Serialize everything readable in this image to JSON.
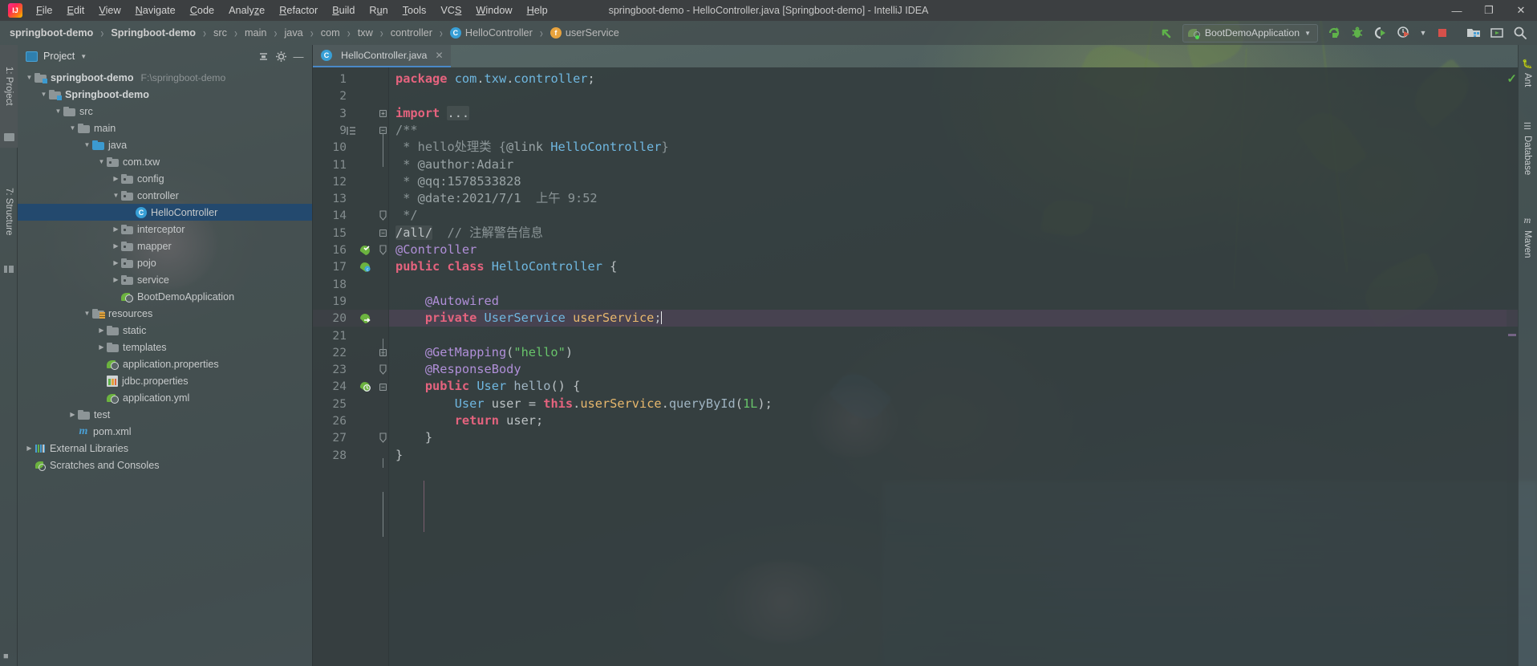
{
  "window": {
    "title": "springboot-demo - HelloController.java [Springboot-demo] - IntelliJ IDEA",
    "minimize_label": "—",
    "maximize_label": "❐",
    "close_label": "✕"
  },
  "menu": {
    "logo_name": "intellij-idea-logo",
    "items": [
      {
        "label": "File",
        "mnemonic": "F"
      },
      {
        "label": "Edit",
        "mnemonic": "E"
      },
      {
        "label": "View",
        "mnemonic": "V"
      },
      {
        "label": "Navigate",
        "mnemonic": "N"
      },
      {
        "label": "Code",
        "mnemonic": "C"
      },
      {
        "label": "Analyze",
        "mnemonic": "z"
      },
      {
        "label": "Refactor",
        "mnemonic": "R"
      },
      {
        "label": "Build",
        "mnemonic": "B"
      },
      {
        "label": "Run",
        "mnemonic": "u"
      },
      {
        "label": "Tools",
        "mnemonic": "T"
      },
      {
        "label": "VCS",
        "mnemonic": "S"
      },
      {
        "label": "Window",
        "mnemonic": "W"
      },
      {
        "label": "Help",
        "mnemonic": "H"
      }
    ]
  },
  "breadcrumb": [
    {
      "label": "springboot-demo",
      "bold": true,
      "icon": ""
    },
    {
      "label": "Springboot-demo",
      "bold": true,
      "icon": ""
    },
    {
      "label": "src",
      "bold": false,
      "icon": ""
    },
    {
      "label": "main",
      "bold": false,
      "icon": ""
    },
    {
      "label": "java",
      "bold": false,
      "icon": ""
    },
    {
      "label": "com",
      "bold": false,
      "icon": ""
    },
    {
      "label": "txw",
      "bold": false,
      "icon": ""
    },
    {
      "label": "controller",
      "bold": false,
      "icon": ""
    },
    {
      "label": "HelloController",
      "bold": false,
      "icon": "class-icon"
    },
    {
      "label": "userService",
      "bold": false,
      "icon": "field-icon"
    }
  ],
  "toolbar": {
    "back_arrow_name": "navigate-back-icon",
    "run_config": {
      "label": "BootDemoApplication",
      "icon_name": "spring-boot-icon",
      "chevron": "▼"
    },
    "buttons": [
      {
        "name": "run-button",
        "glyph": "run",
        "color": "#5fb24a"
      },
      {
        "name": "debug-button",
        "glyph": "debug",
        "color": "#5fb24a"
      },
      {
        "name": "run-with-coverage-button",
        "glyph": "coverage",
        "color": "#5fb24a"
      },
      {
        "name": "profile-button",
        "glyph": "profile",
        "color": "#d65c4a"
      },
      {
        "name": "profile-dropdown",
        "glyph": "chevron",
        "color": "#c0c5c7"
      },
      {
        "name": "stop-button",
        "glyph": "stop",
        "color": "#d6504a"
      },
      {
        "name": "project-structure-button",
        "glyph": "structure",
        "color": "#4a9fd4"
      },
      {
        "name": "update-project-button",
        "glyph": "update",
        "color": "#5fb24a"
      },
      {
        "name": "search-everywhere-button",
        "glyph": "search",
        "color": "#c6cacb"
      }
    ]
  },
  "left_stripe": [
    {
      "label": "1: Project",
      "name": "stripe-project",
      "active": true
    },
    {
      "label": "7: Structure",
      "name": "stripe-structure",
      "active": false
    }
  ],
  "right_stripe": [
    {
      "label": "Ant",
      "name": "stripe-ant"
    },
    {
      "label": "Database",
      "name": "stripe-database"
    },
    {
      "label": "Maven",
      "name": "stripe-maven"
    }
  ],
  "project_panel": {
    "title": "Project",
    "chevron": "▼",
    "collapse_all_label": "≡",
    "settings_label": "⚙",
    "hide_label": "—",
    "tree": [
      {
        "label": "springboot-demo",
        "path": "F:\\springboot-demo",
        "indent": 0,
        "arrow": "down",
        "icon": "module-folder",
        "bold": true,
        "selected": false
      },
      {
        "label": "Springboot-demo",
        "path": "",
        "indent": 1,
        "arrow": "down",
        "icon": "module-folder",
        "bold": true,
        "selected": false
      },
      {
        "label": "src",
        "path": "",
        "indent": 2,
        "arrow": "down",
        "icon": "folder",
        "bold": false,
        "selected": false
      },
      {
        "label": "main",
        "path": "",
        "indent": 3,
        "arrow": "down",
        "icon": "folder",
        "bold": false,
        "selected": false
      },
      {
        "label": "java",
        "path": "",
        "indent": 4,
        "arrow": "down",
        "icon": "source-folder",
        "bold": false,
        "selected": false
      },
      {
        "label": "com.txw",
        "path": "",
        "indent": 5,
        "arrow": "down",
        "icon": "package",
        "bold": false,
        "selected": false
      },
      {
        "label": "config",
        "path": "",
        "indent": 6,
        "arrow": "right",
        "icon": "package",
        "bold": false,
        "selected": false
      },
      {
        "label": "controller",
        "path": "",
        "indent": 6,
        "arrow": "down",
        "icon": "package",
        "bold": false,
        "selected": false
      },
      {
        "label": "HelloController",
        "path": "",
        "indent": 7,
        "arrow": "none",
        "icon": "class",
        "bold": false,
        "selected": true
      },
      {
        "label": "interceptor",
        "path": "",
        "indent": 6,
        "arrow": "right",
        "icon": "package",
        "bold": false,
        "selected": false
      },
      {
        "label": "mapper",
        "path": "",
        "indent": 6,
        "arrow": "right",
        "icon": "package",
        "bold": false,
        "selected": false
      },
      {
        "label": "pojo",
        "path": "",
        "indent": 6,
        "arrow": "right",
        "icon": "package",
        "bold": false,
        "selected": false
      },
      {
        "label": "service",
        "path": "",
        "indent": 6,
        "arrow": "right",
        "icon": "package",
        "bold": false,
        "selected": false
      },
      {
        "label": "BootDemoApplication",
        "path": "",
        "indent": 6,
        "arrow": "none",
        "icon": "spring-class",
        "bold": false,
        "selected": false
      },
      {
        "label": "resources",
        "path": "",
        "indent": 4,
        "arrow": "down",
        "icon": "resource-folder",
        "bold": false,
        "selected": false
      },
      {
        "label": "static",
        "path": "",
        "indent": 5,
        "arrow": "right",
        "icon": "folder",
        "bold": false,
        "selected": false
      },
      {
        "label": "templates",
        "path": "",
        "indent": 5,
        "arrow": "right",
        "icon": "folder",
        "bold": false,
        "selected": false
      },
      {
        "label": "application.properties",
        "path": "",
        "indent": 5,
        "arrow": "none",
        "icon": "spring-config",
        "bold": false,
        "selected": false
      },
      {
        "label": "jdbc.properties",
        "path": "",
        "indent": 5,
        "arrow": "none",
        "icon": "properties",
        "bold": false,
        "selected": false
      },
      {
        "label": "application.yml",
        "path": "",
        "indent": 5,
        "arrow": "none",
        "icon": "spring-config",
        "bold": false,
        "selected": false
      },
      {
        "label": "test",
        "path": "",
        "indent": 3,
        "arrow": "right",
        "icon": "folder",
        "bold": false,
        "selected": false
      },
      {
        "label": "pom.xml",
        "path": "",
        "indent": 3,
        "arrow": "none",
        "icon": "maven",
        "bold": false,
        "selected": false
      },
      {
        "label": "External Libraries",
        "path": "",
        "indent": 0,
        "arrow": "right",
        "icon": "library",
        "bold": false,
        "selected": false
      },
      {
        "label": "Scratches and Consoles",
        "path": "",
        "indent": 0,
        "arrow": "none",
        "icon": "scratch",
        "bold": false,
        "selected": false
      }
    ]
  },
  "editor": {
    "tab": {
      "label": "HelloController.java",
      "icon_name": "java-class-icon",
      "close_label": "✕"
    },
    "inspection_status": "✓",
    "lines": [
      {
        "num": "1",
        "gutter": "",
        "fold": "",
        "html": "<span class=\"kw\">package</span> <span class=\"type\">com</span><span class=\"punc\">.</span><span class=\"type\">txw</span><span class=\"punc\">.</span><span class=\"type\">controller</span><span class=\"punc\">;</span>"
      },
      {
        "num": "2",
        "gutter": "",
        "fold": "",
        "html": ""
      },
      {
        "num": "3",
        "gutter": "",
        "fold": "plus",
        "html": "<span class=\"kw\">import</span> <span class=\"fldbg punc\">...</span>"
      },
      {
        "num": "9",
        "gutter": "indent-guide",
        "fold": "minus",
        "html": "<span class=\"cmt\">/**</span>"
      },
      {
        "num": "10",
        "gutter": "",
        "fold": "",
        "html": "<span class=\"cmt\"> * hello处理类 {</span><span class=\"cmt2\">@link</span> <span class=\"type\">HelloController</span><span class=\"cmt\">}</span>"
      },
      {
        "num": "11",
        "gutter": "",
        "fold": "",
        "html": "<span class=\"cmt\"> * </span><span class=\"cmt2\">@author:Adair</span>"
      },
      {
        "num": "12",
        "gutter": "",
        "fold": "",
        "html": "<span class=\"cmt\"> * </span><span class=\"cmt2\">@qq:1578533828</span>"
      },
      {
        "num": "13",
        "gutter": "",
        "fold": "",
        "html": "<span class=\"cmt\"> * </span><span class=\"cmt2\">@date:2021/7/1</span><span class=\"cmt\">  上午 9:52</span>"
      },
      {
        "num": "14",
        "gutter": "",
        "fold": "end",
        "html": "<span class=\"cmt\"> */</span>"
      },
      {
        "num": "15",
        "gutter": "",
        "fold": "minus",
        "html": "<span class=\"fldbg punc\">/all/</span>  <span class=\"cmt\">// 注解警告信息</span>"
      },
      {
        "num": "16",
        "gutter": "run-class",
        "fold": "end",
        "html": "<span class=\"ann\">@Controller</span>"
      },
      {
        "num": "17",
        "gutter": "bean-class",
        "fold": "",
        "html": "<span class=\"kw\">public</span> <span class=\"kw\">class</span> <span class=\"type\">HelloController</span> <span class=\"punc\">{</span>"
      },
      {
        "num": "18",
        "gutter": "",
        "fold": "",
        "html": ""
      },
      {
        "num": "19",
        "gutter": "",
        "fold": "",
        "html": "    <span class=\"ann\">@Autowired</span>"
      },
      {
        "num": "20",
        "gutter": "autowire",
        "fold": "",
        "html": "    <span class=\"kw\">private</span> <span class=\"type\">UserService</span> <span class=\"fld\">userService</span><span class=\"punc\">;</span><span class=\"caret\"></span>",
        "current": true
      },
      {
        "num": "21",
        "gutter": "",
        "fold": "",
        "html": ""
      },
      {
        "num": "22",
        "gutter": "",
        "fold": "minus",
        "html": "    <span class=\"ann\">@GetMapping</span><span class=\"punc\">(</span><span class=\"str\">\"hello\"</span><span class=\"punc\">)</span>"
      },
      {
        "num": "23",
        "gutter": "",
        "fold": "end",
        "html": "    <span class=\"ann\">@ResponseBody</span>"
      },
      {
        "num": "24",
        "gutter": "mapping",
        "fold": "minus",
        "html": "    <span class=\"kw\">public</span> <span class=\"type\">User</span> <span class=\"mth\">hello</span><span class=\"punc\">()</span> <span class=\"punc\">{</span>"
      },
      {
        "num": "25",
        "gutter": "",
        "fold": "",
        "html": "        <span class=\"type\">User</span> <span class=\"id\">user</span> <span class=\"punc\">=</span> <span class=\"kw\">this</span><span class=\"punc\">.</span><span class=\"fld\">userService</span><span class=\"punc\">.</span><span class=\"mth\">queryById</span><span class=\"punc\">(</span><span class=\"num\">1L</span><span class=\"punc\">);</span>"
      },
      {
        "num": "26",
        "gutter": "",
        "fold": "",
        "html": "        <span class=\"kw\">return</span> <span class=\"id\">user</span><span class=\"punc\">;</span>"
      },
      {
        "num": "27",
        "gutter": "",
        "fold": "end",
        "html": "    <span class=\"punc\">}</span>"
      },
      {
        "num": "28",
        "gutter": "",
        "fold": "",
        "html": "<span class=\"punc\">}</span>"
      }
    ]
  }
}
